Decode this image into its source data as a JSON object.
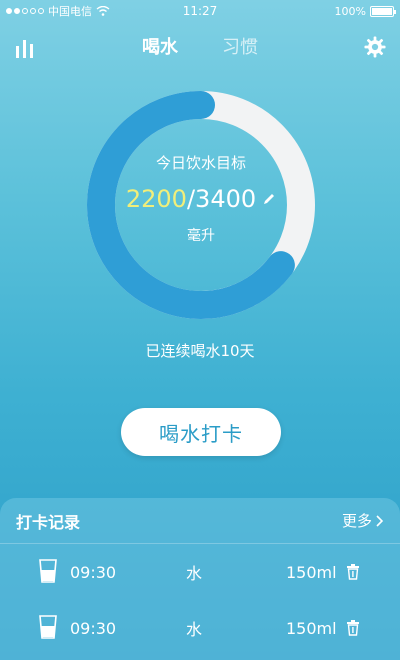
{
  "status_bar": {
    "carrier": "中国电信",
    "time": "11:27",
    "battery": "100%"
  },
  "nav": {
    "tabs": [
      {
        "label": "喝水",
        "active": true
      },
      {
        "label": "习惯",
        "active": false
      }
    ]
  },
  "goal": {
    "title": "今日饮水目标",
    "current": "2200",
    "separator": "/",
    "target": "3400",
    "unit": "毫升",
    "progress_fraction": 0.647
  },
  "streak_text": "已连续喝水10天",
  "checkin_button": "喝水打卡",
  "records": {
    "title": "打卡记录",
    "more": "更多",
    "items": [
      {
        "time": "09:30",
        "type": "水",
        "amount": "150ml"
      },
      {
        "time": "09:30",
        "type": "水",
        "amount": "150ml"
      }
    ]
  },
  "colors": {
    "ring_progress": "#2f9ed6",
    "ring_track": "#f2f3f4",
    "current_value": "#f1ee7a",
    "accent": "#2a9cc7"
  },
  "icons": [
    "stats-icon",
    "settings-icon",
    "edit-icon",
    "cup-icon",
    "trash-icon",
    "chevron-right-icon",
    "wifi-icon",
    "signal-icon",
    "battery-icon"
  ]
}
